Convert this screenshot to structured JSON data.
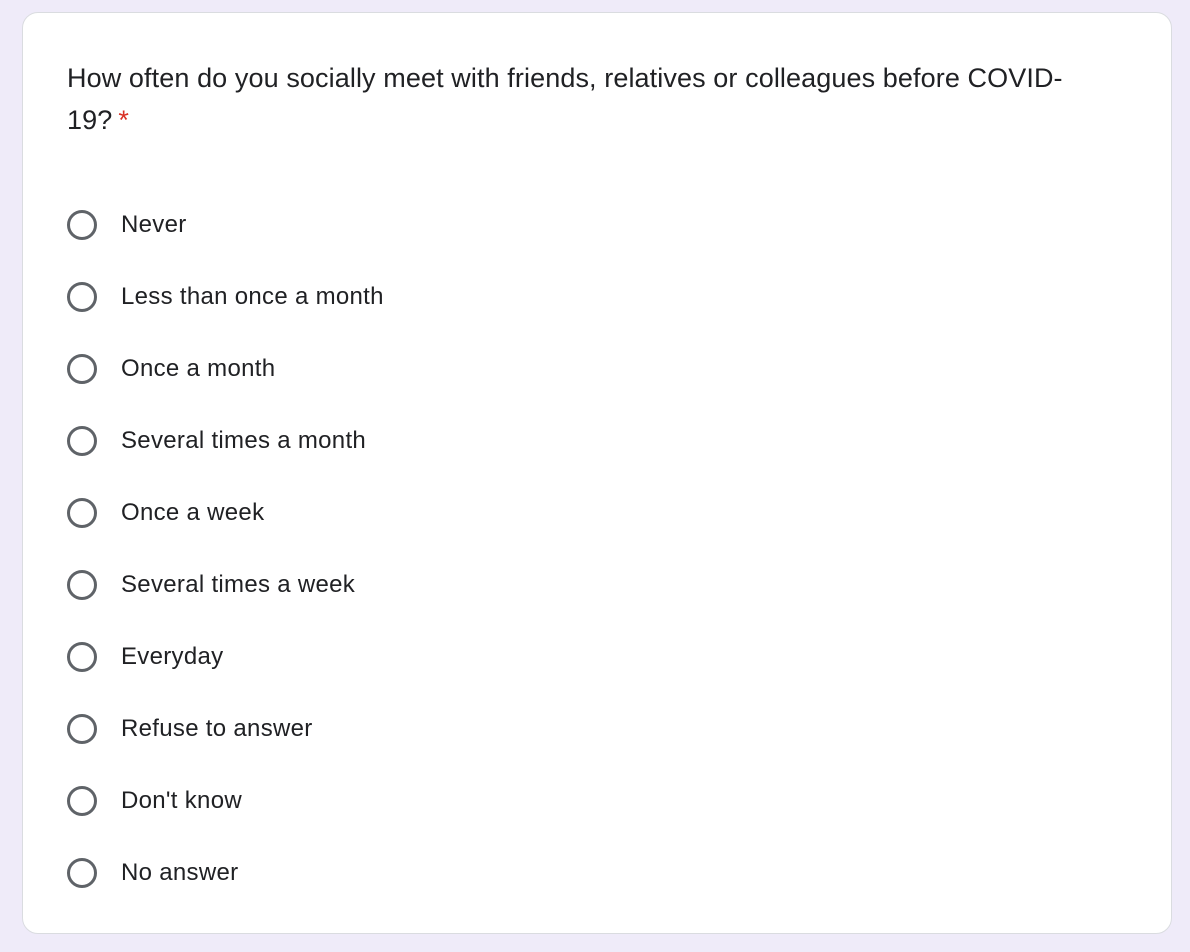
{
  "question": {
    "text": "How often do you socially meet with friends, relatives or colleagues before COVID-19?",
    "required_marker": "*"
  },
  "options": [
    {
      "label": "Never"
    },
    {
      "label": "Less than once a month"
    },
    {
      "label": "Once a month"
    },
    {
      "label": "Several times a month"
    },
    {
      "label": "Once a week"
    },
    {
      "label": "Several times a week"
    },
    {
      "label": "Everyday"
    },
    {
      "label": "Refuse to answer"
    },
    {
      "label": "Don't know"
    },
    {
      "label": "No answer"
    }
  ],
  "colors": {
    "page_background": "#efebf9",
    "card_background": "#ffffff",
    "text": "#202124",
    "required": "#d93025",
    "radio_border": "#5f6368"
  }
}
